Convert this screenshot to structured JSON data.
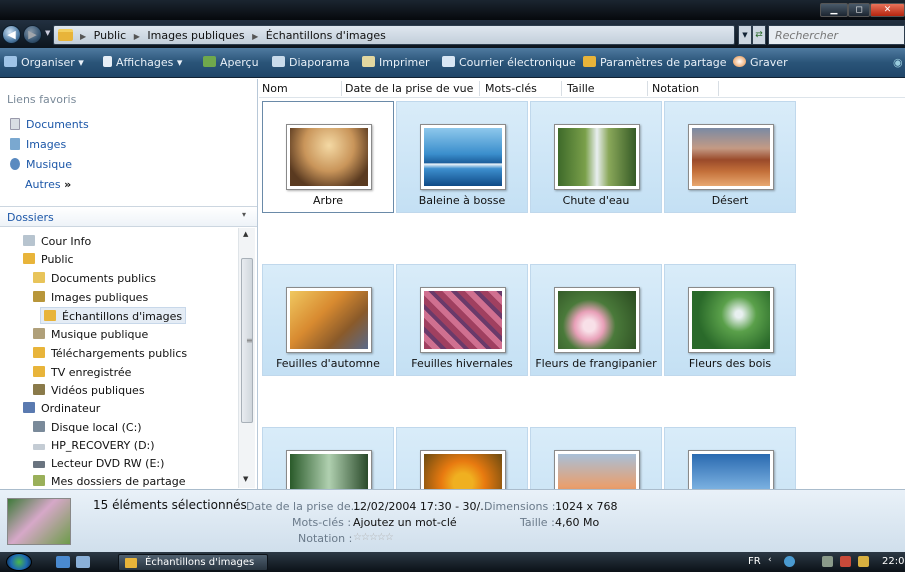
{
  "window": {
    "breadcrumb": [
      "Public",
      "Images publiques",
      "Échantillons d'images"
    ],
    "search_placeholder": "Rechercher"
  },
  "toolbar": {
    "organize": "Organiser",
    "views": "Affichages",
    "preview": "Aperçu",
    "slideshow": "Diaporama",
    "print": "Imprimer",
    "email": "Courrier électronique",
    "sharing": "Paramètres de partage",
    "burn": "Graver"
  },
  "favorites": {
    "header": "Liens favoris",
    "items": [
      "Documents",
      "Images",
      "Musique"
    ],
    "more": "Autres",
    "more_mark": "»"
  },
  "folders": {
    "header": "Dossiers",
    "tree": [
      {
        "label": "Cour Info",
        "icon": "folder-icon"
      },
      {
        "label": "Public",
        "icon": "folder-icon"
      },
      {
        "label": "Documents publics",
        "icon": "documents-folder-icon"
      },
      {
        "label": "Images publiques",
        "icon": "pictures-folder-icon"
      },
      {
        "label": "Échantillons d'images",
        "icon": "folder-icon",
        "selected": true
      },
      {
        "label": "Musique publique",
        "icon": "music-folder-icon"
      },
      {
        "label": "Téléchargements publics",
        "icon": "folder-icon"
      },
      {
        "label": "TV enregistrée",
        "icon": "folder-icon"
      },
      {
        "label": "Vidéos publiques",
        "icon": "videos-folder-icon"
      },
      {
        "label": "Ordinateur",
        "icon": "computer-icon"
      },
      {
        "label": "Disque local (C:)",
        "icon": "drive-icon"
      },
      {
        "label": "HP_RECOVERY (D:)",
        "icon": "drive-icon"
      },
      {
        "label": "Lecteur DVD RW (E:)",
        "icon": "dvd-drive-icon"
      },
      {
        "label": "Mes dossiers de partage",
        "icon": "shared-folder-icon"
      }
    ]
  },
  "columns": [
    "Nom",
    "Date de la prise de vue",
    "Mots-clés",
    "Taille",
    "Notation"
  ],
  "files": [
    {
      "name": "Arbre",
      "icon": "tree-image"
    },
    {
      "name": "Baleine à bosse",
      "icon": "whale-image"
    },
    {
      "name": "Chute d'eau",
      "icon": "waterfall-image"
    },
    {
      "name": "Désert",
      "icon": "desert-image"
    },
    {
      "name": "Feuilles d'automne",
      "icon": "autumn-leaves-image"
    },
    {
      "name": "Feuilles hivernales",
      "icon": "winter-leaves-image"
    },
    {
      "name": "Fleurs de frangipanier",
      "icon": "frangipani-image"
    },
    {
      "name": "Fleurs des bois",
      "icon": "wood-flowers-image"
    },
    {
      "name": "",
      "icon": "forest-image"
    },
    {
      "name": "",
      "icon": "orange-flowers-image"
    },
    {
      "name": "",
      "icon": "dunes-image"
    },
    {
      "name": "",
      "icon": "sky-image"
    }
  ],
  "details": {
    "count": "15 éléments sélectionnés",
    "date_label": "Date de la prise de...",
    "date_value": "12/02/2004 17:30 - 30/...",
    "dimensions_label": "Dimensions :",
    "dimensions_value": "1024 x 768",
    "keywords_label": "Mots-clés :",
    "keywords_value": "Ajoutez un mot-clé",
    "size_label": "Taille :",
    "size_value": "4,60 Mo",
    "rating_label": "Notation :",
    "rating_value": 0
  },
  "taskbar": {
    "task": "Échantillons d'images",
    "lang": "FR",
    "clock": "22:0"
  }
}
